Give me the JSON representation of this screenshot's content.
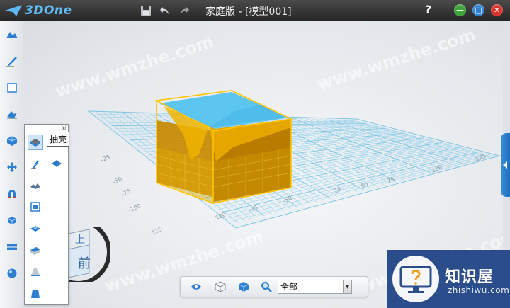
{
  "app": {
    "logo_text": "3DOne",
    "window_title": "家庭版 - [模型001]",
    "help_label": "?"
  },
  "quick_access": [
    {
      "name": "save-icon"
    },
    {
      "name": "undo-icon"
    },
    {
      "name": "redo-icon"
    }
  ],
  "window_controls": {
    "minimize_label": "—",
    "maximize_label": "□",
    "close_label": "✕",
    "colors": {
      "minimize": "#3fa23a",
      "maximize": "#2f7fd0",
      "close": "#d9342b"
    }
  },
  "left_toolbar": [
    "basic-shapes-icon",
    "sketch-icon",
    "sketch-edit-icon",
    "feature-icon",
    "special-feature-icon",
    "transform-icon",
    "assembly-icon",
    "combine-icon",
    "distance-icon",
    "material-icon"
  ],
  "palette": {
    "pin_glyph": "⇲",
    "tools": [
      "shell-icon",
      "fillet-icon",
      "chamfer-icon",
      "draft-icon",
      "thicken-icon",
      "emboss-icon",
      "bevel-icon",
      "loft-icon",
      "sweep-icon"
    ],
    "tooltip": "抽壳"
  },
  "view_cube": {
    "top_label": "上",
    "front_label": "前"
  },
  "grid_labels": [
    "-25",
    "-50",
    "-75",
    "-100",
    "-125",
    "-100",
    "-75",
    "-50",
    "-25",
    "25",
    "50",
    "75",
    "100",
    "125",
    "-25",
    "25",
    "50",
    "75",
    "100",
    "125"
  ],
  "bottom_toolbar": {
    "tools": [
      "eye-icon",
      "view-cube-icon",
      "material-icon",
      "zoom-icon"
    ],
    "filter_value": "全部"
  },
  "watermark": {
    "site_text": "www.wmzhe.com",
    "badge_title": "知识屋",
    "badge_subtitle": "zhishiwu.com"
  },
  "colors": {
    "accent": "#f0b400",
    "model_body": "#c98a00",
    "model_inner": "#5cc6f0",
    "grid": "#7ec6e4",
    "badge_bg": "#2c4d8c"
  }
}
